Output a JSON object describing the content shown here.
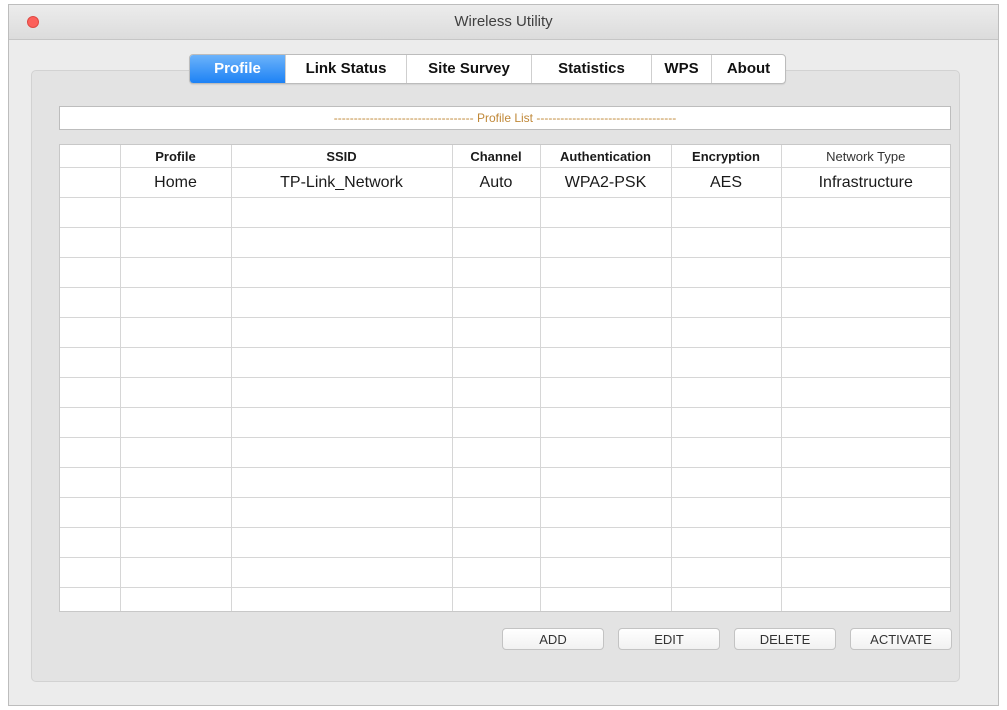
{
  "window": {
    "title": "Wireless Utility"
  },
  "tabs": [
    {
      "label": "Profile",
      "active": true
    },
    {
      "label": "Link Status",
      "active": false
    },
    {
      "label": "Site Survey",
      "active": false
    },
    {
      "label": "Statistics",
      "active": false
    },
    {
      "label": "WPS",
      "active": false
    },
    {
      "label": "About",
      "active": false
    }
  ],
  "profile_list": {
    "label": "----------------------------------- Profile List -----------------------------------"
  },
  "table": {
    "columns": [
      "",
      "Profile",
      "SSID",
      "Channel",
      "Authentication",
      "Encryption",
      "Network Type"
    ],
    "rows": [
      [
        "",
        "Home",
        "TP-Link_Network",
        "Auto",
        "WPA2-PSK",
        "AES",
        "Infrastructure"
      ]
    ]
  },
  "buttons": {
    "add": "ADD",
    "edit": "EDIT",
    "delete": "DELETE",
    "activate": "ACTIVATE"
  },
  "colors": {
    "accent": "#1d82f5",
    "profile_list_text": "#c08838",
    "close": "#fc605b"
  }
}
